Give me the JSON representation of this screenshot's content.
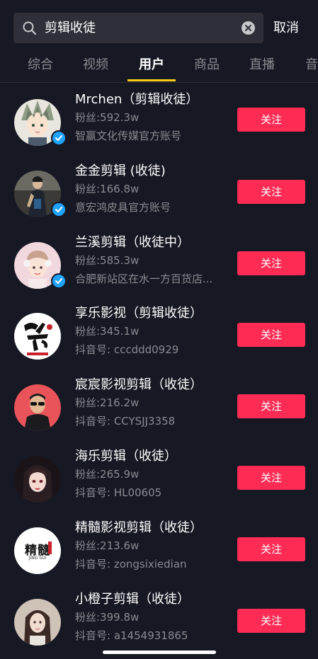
{
  "search": {
    "query": "剪辑收徒",
    "cancel_label": "取消"
  },
  "tabs": [
    {
      "label": "综合"
    },
    {
      "label": "视频"
    },
    {
      "label": "用户",
      "active": true
    },
    {
      "label": "商品"
    },
    {
      "label": "直播"
    },
    {
      "label": "音"
    }
  ],
  "users": [
    {
      "name": "Mrchen（剪辑收徒）",
      "fans": "粉丝:592.3w",
      "desc": "智赢文化传媒官方账号",
      "verified": true,
      "follow_label": "关注",
      "avatar": "anime-boy-avatar"
    },
    {
      "name": "金金剪辑 (收徒)",
      "fans": "粉丝:166.8w",
      "desc": "意宏鸿皮具官方账号",
      "verified": true,
      "follow_label": "关注",
      "avatar": "woman-portrait-avatar"
    },
    {
      "name": "兰溪剪辑（收徒中）",
      "fans": "粉丝:585.3w",
      "desc": "合肥新站区在水一方百货店...",
      "verified": true,
      "follow_label": "关注",
      "avatar": "girl-portrait-avatar"
    },
    {
      "name": "享乐影视（剪辑收徒）",
      "fans": "粉丝:345.1w",
      "desc": "抖音号: cccddd0929",
      "verified": false,
      "follow_label": "关注",
      "avatar": "calligraphy-logo-avatar"
    },
    {
      "name": "宸宸影视剪辑（收徒）",
      "fans": "粉丝:216.2w",
      "desc": "抖音号: CCYSJJ3358",
      "verified": false,
      "follow_label": "关注",
      "avatar": "man-sunglasses-avatar"
    },
    {
      "name": "海乐剪辑（收徒）",
      "fans": "粉丝:265.9w",
      "desc": "抖音号: HL00605",
      "verified": false,
      "follow_label": "关注",
      "avatar": "illustrated-girl-avatar"
    },
    {
      "name": "精髓影视剪辑（收徒）",
      "fans": "粉丝:213.6w",
      "desc": "抖音号: zongsixiedian",
      "verified": false,
      "follow_label": "关注",
      "avatar": "jingsui-logo-avatar",
      "avatar_text": "精髓",
      "avatar_subtext": "JING SUI"
    },
    {
      "name": "小橙子剪辑（收徒）",
      "fans": "粉丝:399.8w",
      "desc": "抖音号: a1454931865",
      "verified": false,
      "follow_label": "关注",
      "avatar": "woman-selfie-avatar"
    }
  ],
  "colors": {
    "background": "#161823",
    "follow_button": "#fe2c55",
    "tab_indicator": "#face15",
    "verified_badge": "#20a3ff"
  }
}
